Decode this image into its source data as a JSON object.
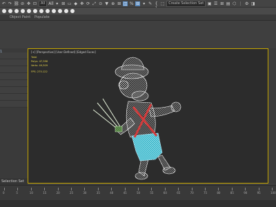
{
  "toolbar": {
    "buttons": [
      "↶",
      "↷",
      "⛓",
      "⊘",
      "✥",
      "⊡",
      "All",
      "▾",
      "⊞",
      "▭",
      "◆",
      "✥",
      "⟳",
      "⤢",
      "⊙",
      "▼",
      "⊕",
      "⊞",
      "◫",
      "%",
      "⊟",
      "▾",
      "✎",
      "{ }",
      "⬚",
      "▣",
      "☰",
      "⊞",
      "▤",
      "⬡",
      "⋮",
      "⚙",
      "◨"
    ],
    "filter_label": "All",
    "selection_set_label": "Create Selection Set"
  },
  "ribbon_labels": [
    "Object Paint",
    "Populate"
  ],
  "left_panel": {
    "curl_label": "1"
  },
  "viewport": {
    "label": "[+] [Perspective] [User Defined] [Edged Faces]",
    "stats": [
      {
        "label": "Total",
        "value": ""
      },
      {
        "label": "Polys:",
        "value": "47,596"
      },
      {
        "label": "Verts:",
        "value": "49,509"
      },
      {
        "label": "FPS:",
        "value": "275.122"
      }
    ],
    "accent": "#c8a800"
  },
  "selection_set": "Selection Set",
  "timeline": {
    "labels": [
      "0",
      "5",
      "10",
      "15",
      "20",
      "25",
      "30",
      "35",
      "40",
      "45",
      "50",
      "55",
      "60",
      "65",
      "70",
      "75",
      "80",
      "85",
      "90",
      "95",
      "100"
    ]
  }
}
